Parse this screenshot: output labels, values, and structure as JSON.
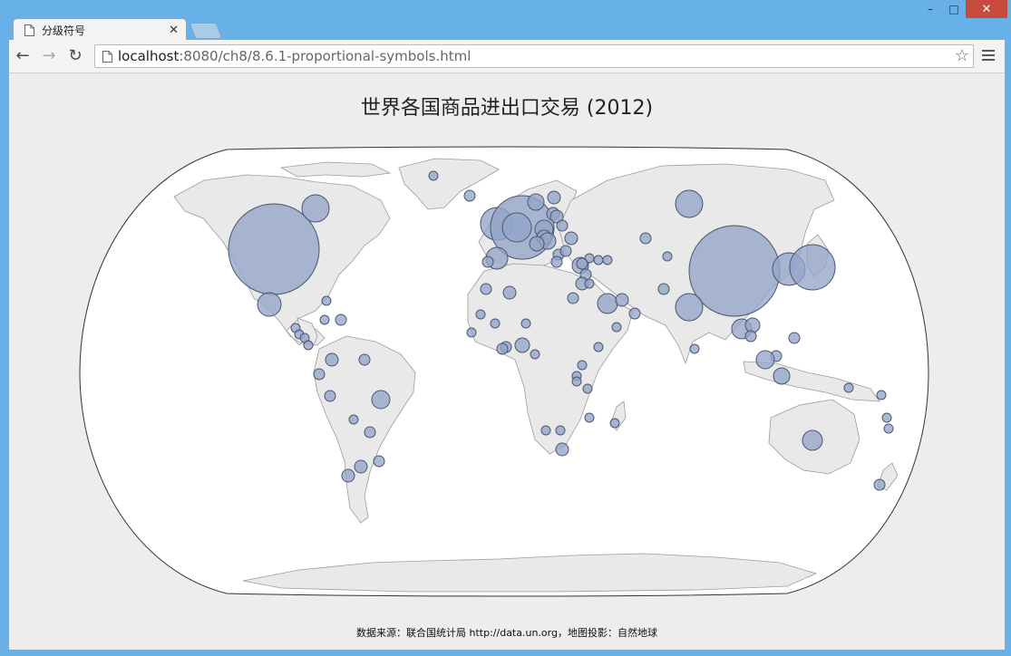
{
  "browser": {
    "tab_title": "分级符号",
    "url_host": "localhost",
    "url_rest": ":8080/ch8/8.6.1-proportional-symbols.html",
    "window_controls": {
      "minimize": "–",
      "maximize": "□",
      "close": "✕"
    },
    "nav": {
      "back": "←",
      "forward": "→",
      "reload": "↻"
    },
    "bookmark_star": "☆",
    "tab_close": "✕"
  },
  "page": {
    "title": "世界各国商品进出口交易 (2012)",
    "source_prefix": "数据来源：联合国统计局 ",
    "source_link": "http://data.un.org",
    "source_suffix": "，地图投影：自然地球"
  },
  "colors": {
    "bubble_fill": "#94a5c8",
    "bubble_stroke": "#4b5570",
    "land": "#e9e9e9",
    "ocean": "#ffffff"
  }
}
